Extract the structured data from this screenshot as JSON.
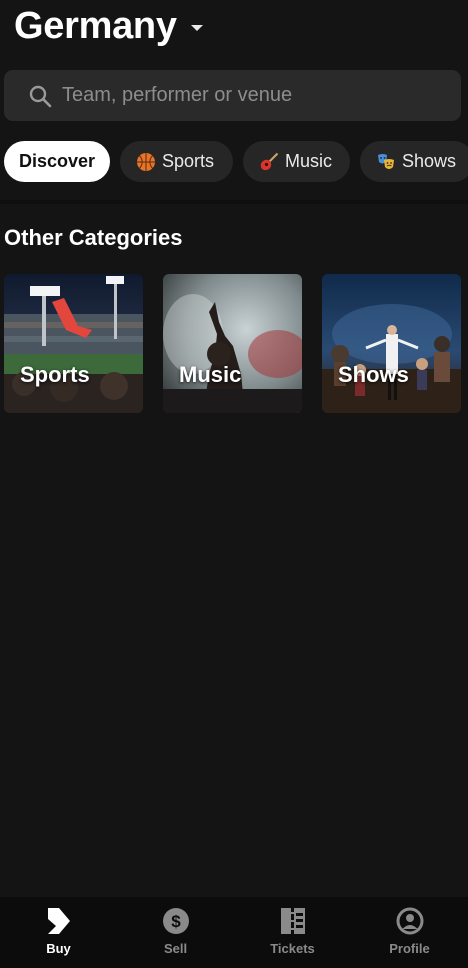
{
  "header": {
    "country": "Germany"
  },
  "search": {
    "placeholder": "Team, performer or venue"
  },
  "chips": [
    {
      "label": "Discover",
      "active": true
    },
    {
      "label": "Sports",
      "icon": "basketball-icon"
    },
    {
      "label": "Music",
      "icon": "guitar-icon"
    },
    {
      "label": "Shows",
      "icon": "theater-masks-icon"
    }
  ],
  "section": {
    "title": "Other Categories"
  },
  "categories": [
    {
      "label": "Sports",
      "image": "stadium-crowd-image"
    },
    {
      "label": "Music",
      "image": "concert-crowd-image"
    },
    {
      "label": "Shows",
      "image": "stage-performance-image"
    }
  ],
  "nav": [
    {
      "label": "Buy",
      "icon": "buy-logo-icon",
      "active": true
    },
    {
      "label": "Sell",
      "icon": "dollar-icon"
    },
    {
      "label": "Tickets",
      "icon": "tickets-icon"
    },
    {
      "label": "Profile",
      "icon": "profile-icon"
    }
  ],
  "colors": {
    "background": "#141414",
    "surface": "#2a2a2a",
    "chip": "#262626",
    "nav": "#0c0c0c"
  }
}
